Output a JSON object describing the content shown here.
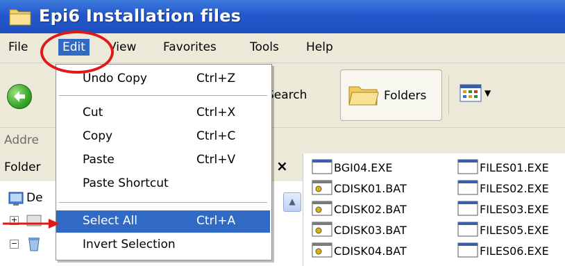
{
  "window": {
    "title": "Epi6 Installation files"
  },
  "menubar": {
    "items": [
      "File",
      "Edit",
      "View",
      "Favorites",
      "Tools",
      "Help"
    ],
    "active": "Edit"
  },
  "toolbar": {
    "search_label": "Search",
    "folders_label": "Folders",
    "back_icon": "back-arrow-icon",
    "views_icon": "views-grid-icon"
  },
  "addressbar": {
    "label": "Addre"
  },
  "folderpane": {
    "header": "Folder",
    "close_glyph": "×",
    "tree": [
      {
        "label": "De",
        "icon": "desktop-icon"
      }
    ]
  },
  "files": {
    "column1": [
      "BGI04.EXE",
      "CDISK01.BAT",
      "CDISK02.BAT",
      "CDISK03.BAT",
      "CDISK04.BAT"
    ],
    "column2": [
      "FILES01.EXE",
      "FILES02.EXE",
      "FILES03.EXE",
      "FILES05.EXE",
      "FILES06.EXE"
    ]
  },
  "edit_menu": {
    "entries": [
      {
        "label": "Undo Copy",
        "shortcut": "Ctrl+Z"
      },
      {
        "label": "Cut",
        "shortcut": "Ctrl+X"
      },
      {
        "label": "Copy",
        "shortcut": "Ctrl+C"
      },
      {
        "label": "Paste",
        "shortcut": "Ctrl+V"
      },
      {
        "label": "Paste Shortcut",
        "shortcut": ""
      },
      {
        "label": "Select All",
        "shortcut": "Ctrl+A",
        "highlighted": true
      },
      {
        "label": "Invert Selection",
        "shortcut": ""
      }
    ]
  },
  "colors": {
    "titlebar": "#2357cb",
    "menu_highlight": "#316ac5",
    "annotation": "#e01818"
  }
}
